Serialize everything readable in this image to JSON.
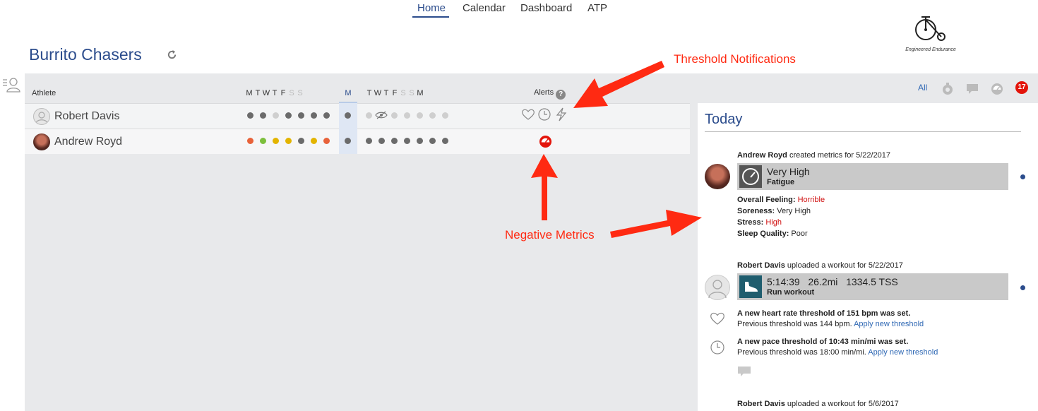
{
  "nav": {
    "items": [
      "Home",
      "Calendar",
      "Dashboard",
      "ATP"
    ],
    "active": "Home"
  },
  "group": {
    "title": "Burrito Chasers"
  },
  "logo": {
    "text": "Engineered Endurance"
  },
  "table": {
    "athlete_header": "Athlete",
    "week1_letters": [
      "M",
      "T",
      "W",
      "T",
      "F",
      "S",
      "S"
    ],
    "current_letter": "M",
    "week2_letters": [
      "T",
      "W",
      "T",
      "F",
      "S",
      "S",
      "M"
    ],
    "alerts_header": "Alerts",
    "help_glyph": "?",
    "rows": [
      {
        "name": "Robert Davis",
        "avatar": "default-avatar",
        "week1_colors": [
          "#6b6b6b",
          "#6b6b6b",
          "#cfcfcf",
          "#6b6b6b",
          "#6b6b6b",
          "#6b6b6b",
          "#6b6b6b"
        ],
        "current_color": "#6b6b6b",
        "week2_colors": [
          "#cfcfcf",
          "hidden-icon",
          "#cfcfcf",
          "#cfcfcf",
          "#cfcfcf",
          "#cfcfcf",
          "#cfcfcf"
        ],
        "alerts": [
          "heart-icon",
          "clock-icon",
          "lightning-icon"
        ]
      },
      {
        "name": "Andrew Royd",
        "avatar": "photo-avatar",
        "week1_colors": [
          "#e8623a",
          "#7cbf3c",
          "#e3b400",
          "#e3b400",
          "#6b6b6b",
          "#e3b400",
          "#e8623a"
        ],
        "current_color": "#6b6b6b",
        "week2_colors": [
          "#6b6b6b",
          "#6b6b6b",
          "#6b6b6b",
          "#6b6b6b",
          "#6b6b6b",
          "#6b6b6b",
          "#6b6b6b"
        ],
        "alerts": [
          "fatigue-gauge-icon"
        ]
      }
    ]
  },
  "filters": {
    "all_label": "All",
    "count": "17"
  },
  "feed": {
    "title": "Today",
    "entry1": {
      "who": "Andrew Royd",
      "action": " created metrics for 5/22/2017",
      "card_main": "Very High",
      "card_sub": "Fatigue",
      "metrics": [
        {
          "label": "Overall Feeling:",
          "value": " Horrible",
          "alert": true
        },
        {
          "label": "Soreness:",
          "value": " Very High",
          "alert": false
        },
        {
          "label": "Stress:",
          "value": " High",
          "alert": true
        },
        {
          "label": "Sleep Quality:",
          "value": " Poor",
          "alert": false
        }
      ]
    },
    "entry2": {
      "who": "Robert Davis",
      "action": " uploaded a workout for 5/22/2017",
      "card_main": "5:14:39   26.2mi   1334.5 TSS",
      "card_sub": "Run workout",
      "hr_bold": "A new heart rate threshold of 151 bpm was set.",
      "hr_prev": "Previous threshold was 144 bpm. ",
      "pace_bold": "A new pace threshold of 10:43 min/mi was set.",
      "pace_prev": "Previous threshold was 18:00 min/mi. ",
      "apply": "Apply new threshold"
    },
    "entry3": {
      "who": "Robert Davis",
      "action": " uploaded a workout for 5/6/2017"
    }
  },
  "annotations": {
    "threshold": "Threshold Notifications",
    "negative": "Negative Metrics",
    "color": "#ff2a12"
  }
}
